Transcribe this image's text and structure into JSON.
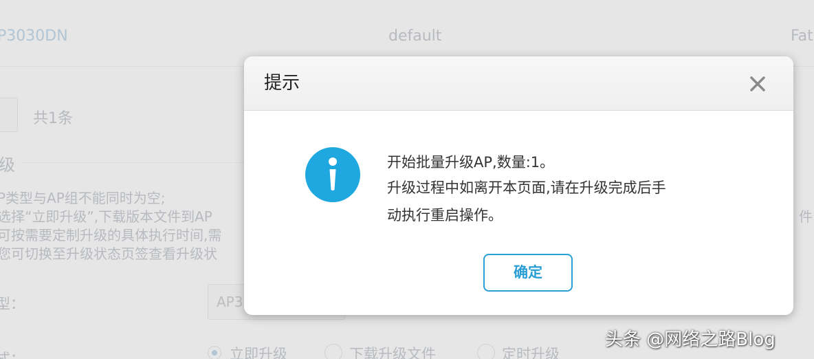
{
  "background": {
    "ap_model": "P3030DN",
    "ap_group": "default",
    "ap_mode_partial": "Fat",
    "pagination_total": "共1条",
    "section_title_partial": "级",
    "notes": [
      "P类型与AP组不能同时为空;",
      "选择“立即升级”,下载版本文件到AP",
      "可按需要定制升级的具体执行时间,需",
      "您可切换至升级状态页签查看升级状"
    ],
    "right_edge_text": "件",
    "type_label_partial": "型：",
    "type_input_value": "AP3",
    "mode_label_partial": "式：",
    "radio_options": [
      "立即升级",
      "下载升级文件",
      "定时升级"
    ]
  },
  "dialog": {
    "title": "提示",
    "close_icon": "close-icon",
    "info_icon": "info-icon",
    "message_lines": [
      "开始批量升级AP,数量:1。",
      "升级过程中如离开本页面,请在升级完成后手",
      "动执行重启操作。"
    ],
    "ok_label": "确定",
    "accent_color": "#2a9fd6"
  },
  "watermark": "头条 @网络之路Blog"
}
